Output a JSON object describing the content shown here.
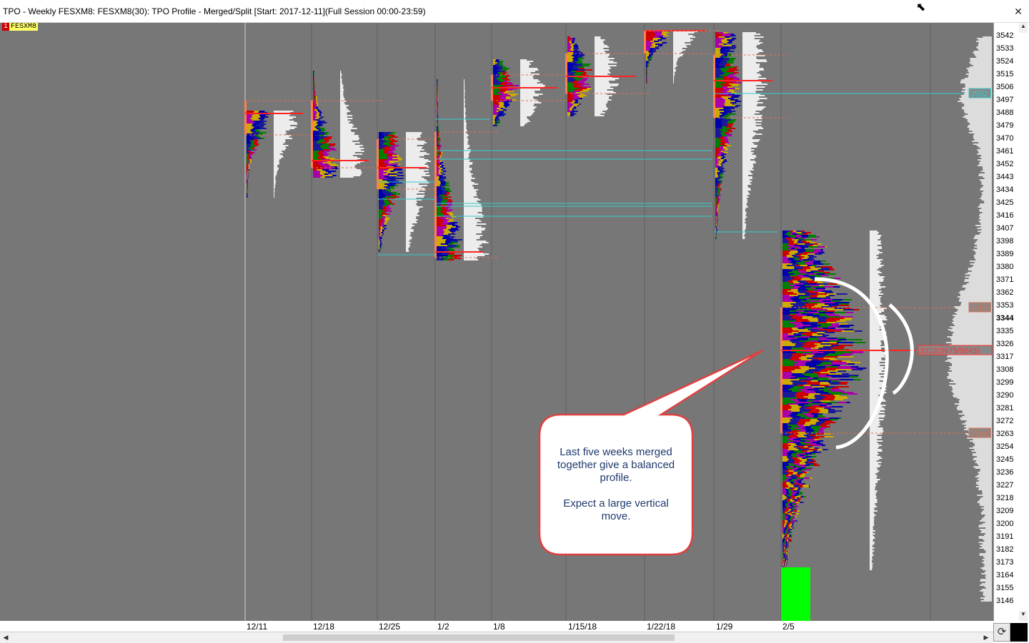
{
  "window": {
    "title": "TPO - Weekly FESXM8: FESXM8(30): TPO Profile - Merged/Split [Start: 2017-12-11](Full Session 00:00-23:59)",
    "symbol_tag": "FESXM8",
    "symbol_icon": "i",
    "m_badge": "M"
  },
  "annotation": {
    "text": "Last five weeks merged\ntogether give a balanced\nprofile.\n\nExpect a large vertical\nmove."
  },
  "chart_data": {
    "type": "tpo_profile",
    "y_ticks": [
      3542,
      3533,
      3524,
      3515,
      3506,
      3497,
      3488,
      3479,
      3470,
      3461,
      3452,
      3443,
      3434,
      3425,
      3416,
      3407,
      3398,
      3389,
      3380,
      3371,
      3362,
      3353,
      3344,
      3335,
      3326,
      3317,
      3308,
      3299,
      3290,
      3281,
      3272,
      3263,
      3254,
      3245,
      3236,
      3227,
      3218,
      3209,
      3200,
      3191,
      3182,
      3173,
      3164,
      3155,
      3146
    ],
    "ylim": [
      3142,
      3546
    ],
    "current_price": 3344,
    "price_tags": [
      {
        "value": 3502,
        "label": "3502",
        "color": "#33cccc"
      },
      {
        "value": 3352,
        "label": "3352",
        "color": "#e07050"
      },
      {
        "value": 3264,
        "label": "3264",
        "color": "#e07050"
      },
      {
        "value": 3322,
        "label": "3322(3875/5845)",
        "color": "#ff3333"
      }
    ],
    "weeks": [
      {
        "label": "12/11",
        "high": 3490,
        "low": 3429,
        "poc": 3488,
        "vah": 3497,
        "val": 3473
      },
      {
        "label": "12/18",
        "high": 3518,
        "low": 3443,
        "poc": 3455,
        "vah": 3497,
        "val": 3450
      },
      {
        "label": "12/25",
        "high": 3475,
        "low": 3391,
        "poc": 3450,
        "vah": 3470,
        "val": 3435
      },
      {
        "label": "1/2",
        "high": 3512,
        "low": 3385,
        "poc": 3391,
        "vah": 3475,
        "val": 3387
      },
      {
        "label": "1/8",
        "high": 3526,
        "low": 3479,
        "poc": 3506,
        "vah": 3515,
        "val": 3497
      },
      {
        "label": "1/15/18",
        "high": 3542,
        "low": 3486,
        "poc": 3514,
        "vah": 3530,
        "val": 3502
      },
      {
        "label": "1/22/18",
        "high": 3546,
        "low": 3509,
        "poc": 3546,
        "vah": 3546,
        "val": 3530
      },
      {
        "label": "1/29",
        "high": 3545,
        "low": 3400,
        "poc": 3511,
        "vah": 3529,
        "val": 3485
      },
      {
        "label": "2/5",
        "high": 3406,
        "low": 3168,
        "poc": 3322,
        "vah": 3352,
        "val": 3264
      }
    ],
    "composite_profile": {
      "poc": 3322,
      "vah": 3352,
      "val": 3264
    }
  }
}
